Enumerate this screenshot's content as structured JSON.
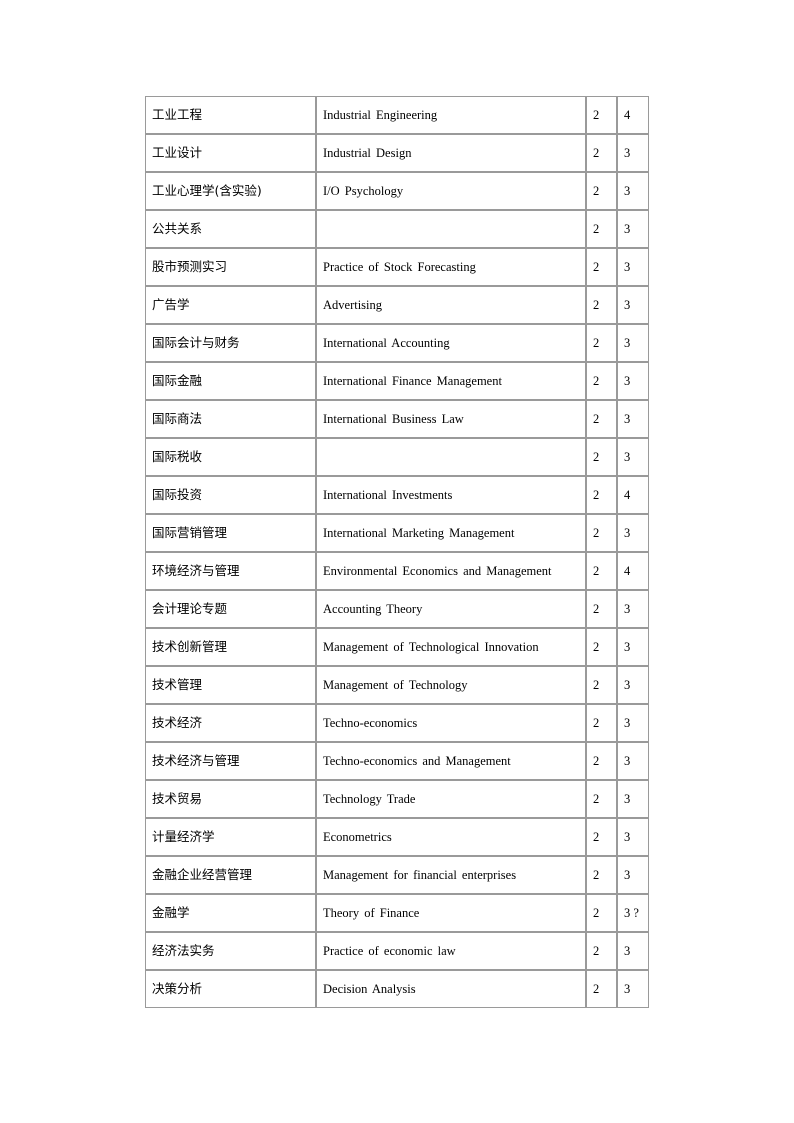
{
  "document": {
    "page_background": "#ffffff",
    "border_color": "#9a9a9a"
  },
  "table": {
    "columns": [
      {
        "key": "chinese_name",
        "role": "course-name-chinese"
      },
      {
        "key": "english_name",
        "role": "course-name-english"
      },
      {
        "key": "credits",
        "role": "credits"
      },
      {
        "key": "hours",
        "role": "hours"
      }
    ],
    "rows": [
      {
        "chinese_name": "工业工程",
        "english_name": "Industrial Engineering",
        "credits": "2",
        "hours": "4"
      },
      {
        "chinese_name": "工业设计",
        "english_name": "Industrial Design",
        "credits": "2",
        "hours": "3"
      },
      {
        "chinese_name": "工业心理学(含实验)",
        "english_name": "I/O Psychology",
        "credits": "2",
        "hours": "3"
      },
      {
        "chinese_name": "公共关系",
        "english_name": "",
        "credits": "2",
        "hours": "3"
      },
      {
        "chinese_name": "股市预测实习",
        "english_name": "Practice of Stock Forecasting",
        "credits": "2",
        "hours": "3"
      },
      {
        "chinese_name": "广告学",
        "english_name": "Advertising",
        "credits": "2",
        "hours": "3"
      },
      {
        "chinese_name": "国际会计与财务",
        "english_name": "International Accounting",
        "credits": "2",
        "hours": "3"
      },
      {
        "chinese_name": "国际金融",
        "english_name": "International Finance Management",
        "credits": "2",
        "hours": "3"
      },
      {
        "chinese_name": "国际商法",
        "english_name": "International Business Law",
        "credits": "2",
        "hours": "3"
      },
      {
        "chinese_name": "国际税收",
        "english_name": "",
        "credits": "2",
        "hours": "3"
      },
      {
        "chinese_name": "国际投资",
        "english_name": "International Investments",
        "credits": "2",
        "hours": "4"
      },
      {
        "chinese_name": "国际营销管理",
        "english_name": "International Marketing Management",
        "credits": "2",
        "hours": "3"
      },
      {
        "chinese_name": "环境经济与管理",
        "english_name": "Environmental Economics and Management",
        "credits": "2",
        "hours": "4"
      },
      {
        "chinese_name": "会计理论专题",
        "english_name": "Accounting Theory",
        "credits": "2",
        "hours": "3"
      },
      {
        "chinese_name": "技术创新管理",
        "english_name": "Management of Technological Innovation",
        "credits": "2",
        "hours": "3"
      },
      {
        "chinese_name": "技术管理",
        "english_name": "Management of Technology",
        "credits": "2",
        "hours": "3"
      },
      {
        "chinese_name": "技术经济",
        "english_name": "Techno-economics",
        "credits": "2",
        "hours": "3"
      },
      {
        "chinese_name": "技术经济与管理",
        "english_name": "Techno-economics and Management",
        "credits": "2",
        "hours": "3"
      },
      {
        "chinese_name": "技术贸易",
        "english_name": "Technology Trade",
        "credits": "2",
        "hours": "3"
      },
      {
        "chinese_name": "计量经济学",
        "english_name": "Econometrics",
        "credits": "2",
        "hours": "3"
      },
      {
        "chinese_name": "金融企业经营管理",
        "english_name": "Management for financial enterprises",
        "credits": "2",
        "hours": "3"
      },
      {
        "chinese_name": "金融学",
        "english_name": "Theory of Finance",
        "credits": "2",
        "hours": "3 ?"
      },
      {
        "chinese_name": "经济法实务",
        "english_name": "Practice of economic law",
        "credits": "2",
        "hours": "3"
      },
      {
        "chinese_name": "决策分析",
        "english_name": "Decision Analysis",
        "credits": "2",
        "hours": "3"
      }
    ]
  }
}
